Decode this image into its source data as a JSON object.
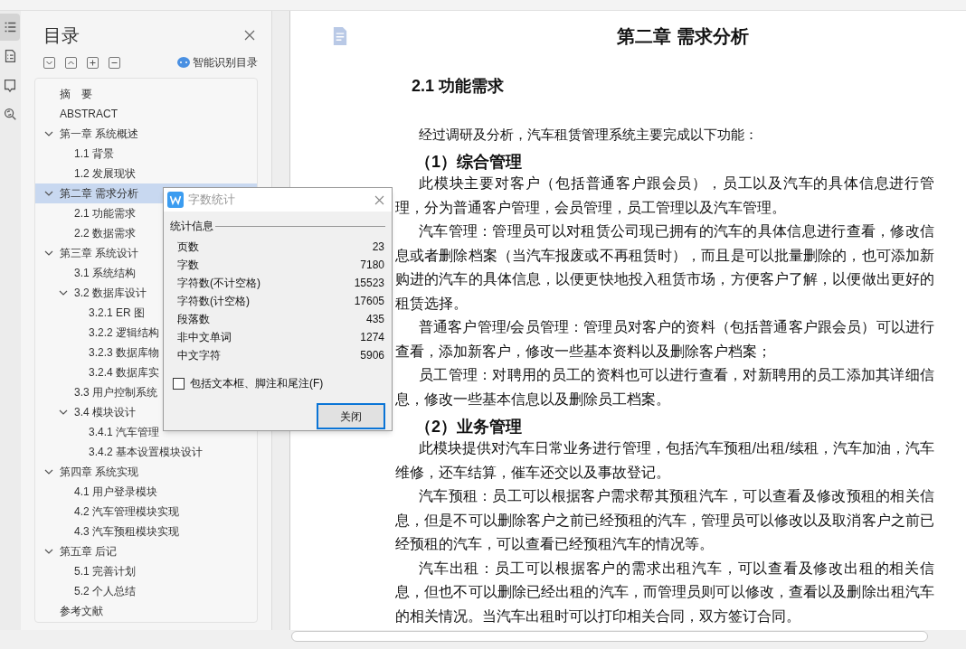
{
  "side_tools": [
    {
      "selected": true
    },
    {
      "selected": false
    },
    {
      "selected": false
    },
    {
      "selected": false
    }
  ],
  "toc_panel": {
    "title": "目录",
    "smart_button": "智能识别目录",
    "items": [
      {
        "label": "摘　要",
        "selected": false
      },
      {
        "label": "ABSTRACT",
        "selected": false
      },
      {
        "label": "第一章  系统概述",
        "selected": false,
        "expanded": true,
        "children": [
          {
            "label": "1.1 背景",
            "selected": false
          },
          {
            "label": "1.2 发展现状",
            "selected": false
          }
        ]
      },
      {
        "label": "第二章  需求分析",
        "selected": true,
        "expanded": true,
        "children": [
          {
            "label": "2.1  功能需求",
            "selected": false
          },
          {
            "label": "2.2  数据需求",
            "selected": false
          }
        ]
      },
      {
        "label": "第三章  系统设计",
        "selected": false,
        "expanded": true,
        "children": [
          {
            "label": "3.1 系统结构",
            "selected": false
          },
          {
            "label": "3.2  数据库设计",
            "selected": false,
            "expanded": true,
            "children": [
              {
                "label": "3.2.1 ER 图",
                "selected": false
              },
              {
                "label": "3.2.2  逻辑结构",
                "selected": false
              },
              {
                "label": "3.2.3  数据库物",
                "selected": false
              },
              {
                "label": "3.2.4  数据库实",
                "selected": false
              }
            ]
          },
          {
            "label": "3.3 用户控制系统",
            "selected": false
          },
          {
            "label": "3.4 模块设计",
            "selected": false,
            "expanded": true,
            "children": [
              {
                "label": "3.4.1  汽车管理",
                "selected": false
              },
              {
                "label": "3.4.2  基本设置模块设计",
                "selected": false
              }
            ]
          }
        ]
      },
      {
        "label": "第四章  系统实现",
        "selected": false,
        "expanded": true,
        "children": [
          {
            "label": "4.1 用户登录模块",
            "selected": false
          },
          {
            "label": "4.2 汽车管理模块实现",
            "selected": false
          },
          {
            "label": "4.3 汽车预租模块实现",
            "selected": false
          }
        ]
      },
      {
        "label": "第五章  后记",
        "selected": false,
        "expanded": true,
        "children": [
          {
            "label": "5.1 完善计划",
            "selected": false
          },
          {
            "label": "5.2 个人总结",
            "selected": false
          }
        ]
      },
      {
        "label": "参考文献",
        "selected": false
      }
    ]
  },
  "document": {
    "title": "第二章  需求分析",
    "blocks": [
      {
        "kind": "section",
        "text": "2.1  功能需求"
      },
      {
        "kind": "intro",
        "text": "经过调研及分析，汽车租赁管理系统主要完成以下功能："
      },
      {
        "kind": "subsection",
        "text": "（1）综合管理"
      },
      {
        "kind": "paragraph",
        "text": "此模块主要对客户（包括普通客户跟会员），员工以及汽车的具体信息进行管理，分为普通客户管理，会员管理，员工管理以及汽车管理。"
      },
      {
        "kind": "paragraph",
        "text": "汽车管理：管理员可以对租赁公司现已拥有的汽车的具体信息进行查看，修改信息或者删除档案（当汽车报废或不再租赁时），而且是可以批量删除的，也可添加新购进的汽车的具体信息，以便更快地投入租赁市场，方便客户了解，以便做出更好的租赁选择。"
      },
      {
        "kind": "paragraph",
        "text": "普通客户管理/会员管理：管理员对客户的资料（包括普通客户跟会员）可以进行查看，添加新客户，修改一些基本资料以及删除客户档案；"
      },
      {
        "kind": "paragraph",
        "text": "员工管理：对聘用的员工的资料也可以进行查看，对新聘用的员工添加其详细信息，修改一些基本信息以及删除员工档案。"
      },
      {
        "kind": "subsection",
        "text": "（2）业务管理"
      },
      {
        "kind": "paragraph",
        "text": "此模块提供对汽车日常业务进行管理，包括汽车预租/出租/续租，汽车加油，汽车维修，还车结算，催车还交以及事故登记。"
      },
      {
        "kind": "paragraph",
        "text": "汽车预租：员工可以根据客户需求帮其预租汽车，可以查看及修改预租的相关信息，但是不可以删除客户之前已经预租的汽车，管理员可以修改以及取消客户之前已经预租的汽车，可以查看已经预租汽车的情况等。"
      },
      {
        "kind": "paragraph",
        "text": "汽车出租：员工可以根据客户的需求出租汽车，可以查看及修改出租的相关信息，但也不可以删除已经出租的汽车，而管理员则可以修改，查看以及删除出租汽车的相关情况。当汽车出租时可以打印相关合同，双方签订合同。"
      }
    ]
  },
  "dialog": {
    "title": "字数统计",
    "group": "统计信息",
    "stats": [
      {
        "label": "页数",
        "value": "23"
      },
      {
        "label": "字数",
        "value": "7180"
      },
      {
        "label": "字符数(不计空格)",
        "value": "15523"
      },
      {
        "label": "字符数(计空格)",
        "value": "17605"
      },
      {
        "label": "段落数",
        "value": "435"
      },
      {
        "label": "非中文单词",
        "value": "1274"
      },
      {
        "label": "中文字符",
        "value": "5906"
      }
    ],
    "checkbox": {
      "label": "包括文本框、脚注和尾注(F)",
      "checked": false
    },
    "close_button": "关闭"
  }
}
